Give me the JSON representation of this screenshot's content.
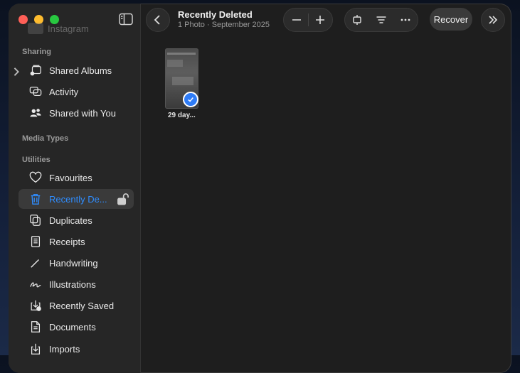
{
  "sidebar": {
    "ghost_item": "Instagram",
    "sections": {
      "sharing": "Sharing",
      "media_types": "Media Types",
      "utilities": "Utilities"
    },
    "sharing_items": [
      {
        "label": "Shared Albums",
        "icon": "shared-albums-icon"
      },
      {
        "label": "Activity",
        "icon": "activity-icon"
      },
      {
        "label": "Shared with You",
        "icon": "shared-with-you-icon"
      }
    ],
    "utility_items": [
      {
        "label": "Favourites",
        "icon": "heart-icon"
      },
      {
        "label": "Recently De...",
        "icon": "trash-icon",
        "selected": true
      },
      {
        "label": "Duplicates",
        "icon": "duplicates-icon"
      },
      {
        "label": "Receipts",
        "icon": "receipt-icon"
      },
      {
        "label": "Handwriting",
        "icon": "pen-icon"
      },
      {
        "label": "Illustrations",
        "icon": "illustrations-icon"
      },
      {
        "label": "Recently Saved",
        "icon": "recently-saved-icon"
      },
      {
        "label": "Documents",
        "icon": "document-icon"
      },
      {
        "label": "Imports",
        "icon": "import-icon"
      }
    ]
  },
  "toolbar": {
    "title": "Recently Deleted",
    "subtitle": "1 Photo · September 2025",
    "recover_label": "Recover"
  },
  "grid": {
    "items": [
      {
        "label": "29 day...",
        "selected": true
      }
    ]
  },
  "colors": {
    "accent": "#2f8dff",
    "window_bg": "#1e1e1e",
    "sidebar_bg": "#262626"
  }
}
